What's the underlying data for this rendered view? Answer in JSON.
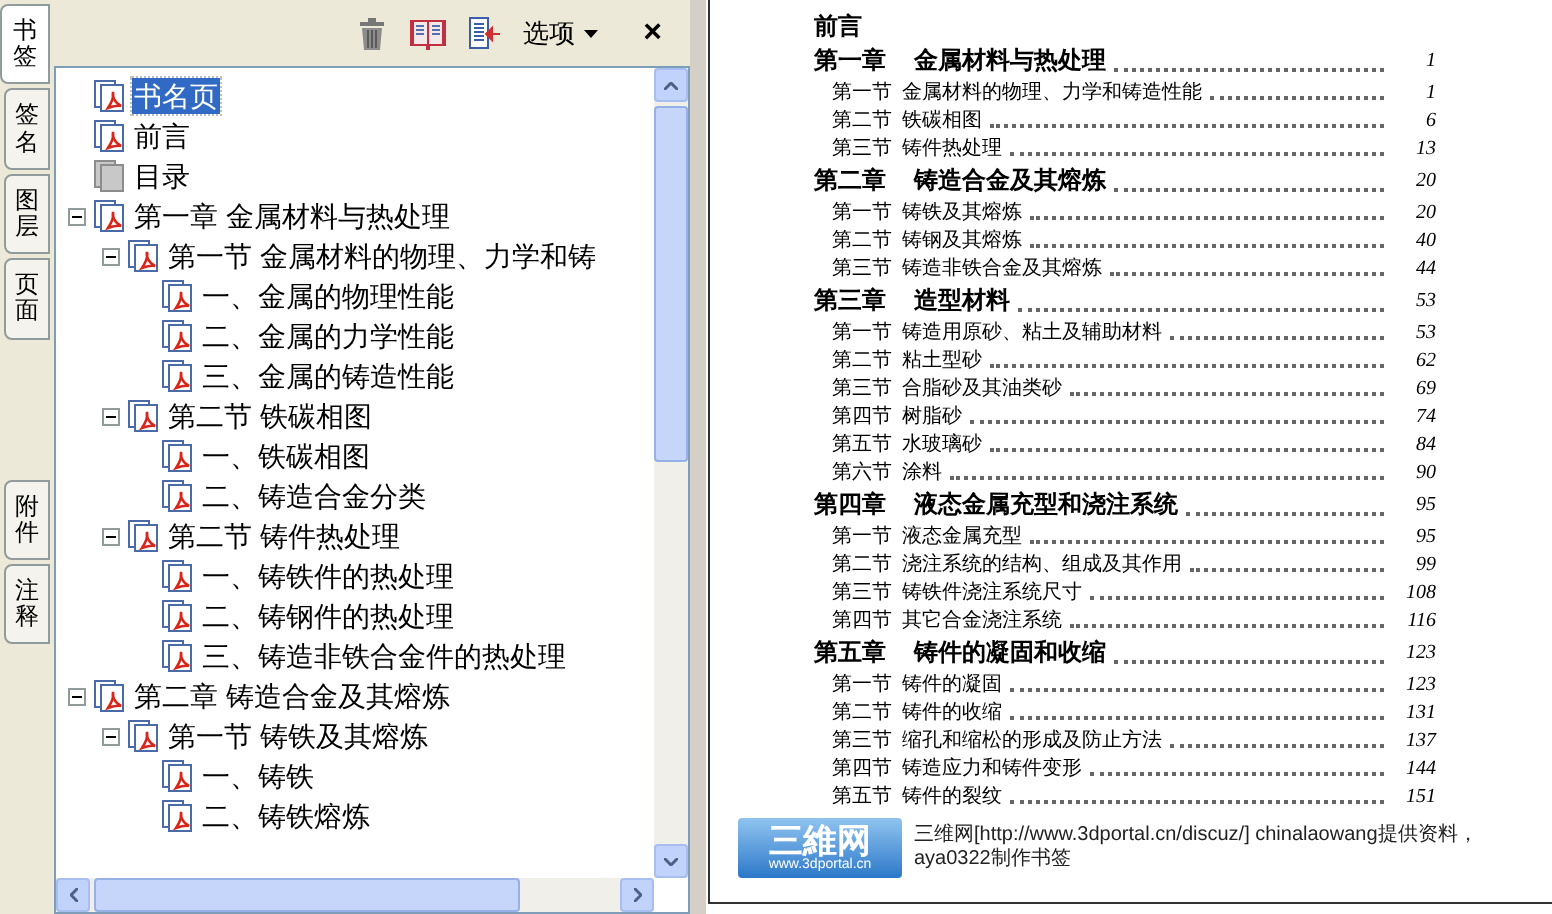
{
  "side_tabs": [
    {
      "label": "书签",
      "selected": true
    },
    {
      "label": "签名",
      "selected": false
    },
    {
      "label": "图层",
      "selected": false
    },
    {
      "label": "页面",
      "selected": false
    },
    {
      "label": "附件",
      "selected": false
    },
    {
      "label": "注释",
      "selected": false
    }
  ],
  "toolbar": {
    "options_label": "选项",
    "close_label": "×"
  },
  "bookmarks": [
    {
      "label": "书名页",
      "kind": "pdf",
      "selected": true
    },
    {
      "label": "前言",
      "kind": "pdf",
      "selected": false
    },
    {
      "label": "目录",
      "kind": "blank",
      "selected": false
    },
    {
      "label": "第一章 金属材料与热处理",
      "kind": "pdf",
      "selected": false,
      "expanded": true,
      "children": [
        {
          "label": "第一节 金属材料的物理、力学和铸",
          "kind": "pdf",
          "selected": false,
          "expanded": true,
          "children": [
            {
              "label": "一、金属的物理性能",
              "kind": "pdf",
              "selected": false
            },
            {
              "label": "二、金属的力学性能",
              "kind": "pdf",
              "selected": false
            },
            {
              "label": "三、金属的铸造性能",
              "kind": "pdf",
              "selected": false
            }
          ]
        },
        {
          "label": "第二节 铁碳相图",
          "kind": "pdf",
          "selected": false,
          "expanded": true,
          "children": [
            {
              "label": "一、铁碳相图",
              "kind": "pdf",
              "selected": false
            },
            {
              "label": "二、铸造合金分类",
              "kind": "pdf",
              "selected": false
            }
          ]
        },
        {
          "label": "第二节 铸件热处理",
          "kind": "pdf",
          "selected": false,
          "expanded": true,
          "children": [
            {
              "label": "一、铸铁件的热处理",
              "kind": "pdf",
              "selected": false
            },
            {
              "label": "二、铸钢件的热处理",
              "kind": "pdf",
              "selected": false
            },
            {
              "label": "三、铸造非铁合金件的热处理",
              "kind": "pdf",
              "selected": false
            }
          ]
        }
      ]
    },
    {
      "label": "第二章 铸造合金及其熔炼",
      "kind": "pdf",
      "selected": false,
      "expanded": true,
      "children": [
        {
          "label": "第一节 铸铁及其熔炼",
          "kind": "pdf",
          "selected": false,
          "expanded": true,
          "children": [
            {
              "label": "一、铸铁",
              "kind": "pdf",
              "selected": false
            },
            {
              "label": "二、铸铁熔炼",
              "kind": "pdf",
              "selected": false
            }
          ]
        }
      ]
    }
  ],
  "toc": [
    {
      "kind": "preface",
      "title": "前言"
    },
    {
      "kind": "chapter",
      "label": "第一章",
      "title": "金属材料与热处理",
      "page": "1"
    },
    {
      "kind": "section",
      "label": "第一节",
      "title": "金属材料的物理、力学和铸造性能",
      "page": "1"
    },
    {
      "kind": "section",
      "label": "第二节",
      "title": "铁碳相图",
      "page": "6"
    },
    {
      "kind": "section",
      "label": "第三节",
      "title": "铸件热处理",
      "page": "13"
    },
    {
      "kind": "chapter",
      "label": "第二章",
      "title": "铸造合金及其熔炼",
      "page": "20"
    },
    {
      "kind": "section",
      "label": "第一节",
      "title": "铸铁及其熔炼",
      "page": "20"
    },
    {
      "kind": "section",
      "label": "第二节",
      "title": "铸钢及其熔炼",
      "page": "40"
    },
    {
      "kind": "section",
      "label": "第三节",
      "title": "铸造非铁合金及其熔炼",
      "page": "44"
    },
    {
      "kind": "chapter",
      "label": "第三章",
      "title": "造型材料",
      "page": "53"
    },
    {
      "kind": "section",
      "label": "第一节",
      "title": "铸造用原砂、粘土及辅助材料",
      "page": "53"
    },
    {
      "kind": "section",
      "label": "第二节",
      "title": "粘土型砂",
      "page": "62"
    },
    {
      "kind": "section",
      "label": "第三节",
      "title": "合脂砂及其油类砂",
      "page": "69"
    },
    {
      "kind": "section",
      "label": "第四节",
      "title": "树脂砂",
      "page": "74"
    },
    {
      "kind": "section",
      "label": "第五节",
      "title": "水玻璃砂",
      "page": "84"
    },
    {
      "kind": "section",
      "label": "第六节",
      "title": "涂料",
      "page": "90"
    },
    {
      "kind": "chapter",
      "label": "第四章",
      "title": "液态金属充型和浇注系统",
      "page": "95"
    },
    {
      "kind": "section",
      "label": "第一节",
      "title": "液态金属充型",
      "page": "95"
    },
    {
      "kind": "section",
      "label": "第二节",
      "title": "浇注系统的结构、组成及其作用",
      "page": "99"
    },
    {
      "kind": "section",
      "label": "第三节",
      "title": "铸铁件浇注系统尺寸",
      "page": "108"
    },
    {
      "kind": "section",
      "label": "第四节",
      "title": "其它合金浇注系统",
      "page": "116"
    },
    {
      "kind": "chapter",
      "label": "第五章",
      "title": "铸件的凝固和收缩",
      "page": "123"
    },
    {
      "kind": "section",
      "label": "第一节",
      "title": "铸件的凝固",
      "page": "123"
    },
    {
      "kind": "section",
      "label": "第二节",
      "title": "铸件的收缩",
      "page": "131"
    },
    {
      "kind": "section",
      "label": "第三节",
      "title": "缩孔和缩松的形成及防止方法",
      "page": "137"
    },
    {
      "kind": "section",
      "label": "第四节",
      "title": "铸造应力和铸件变形",
      "page": "144"
    },
    {
      "kind": "section",
      "label": "第五节",
      "title": "铸件的裂纹",
      "page": "151"
    }
  ],
  "footer": {
    "logo_text": "三維网",
    "logo_url": "www.3dportal.cn",
    "note": "三维网[http://www.3dportal.cn/discuz/] chinalaowang提供资料，aya0322制作书签"
  }
}
